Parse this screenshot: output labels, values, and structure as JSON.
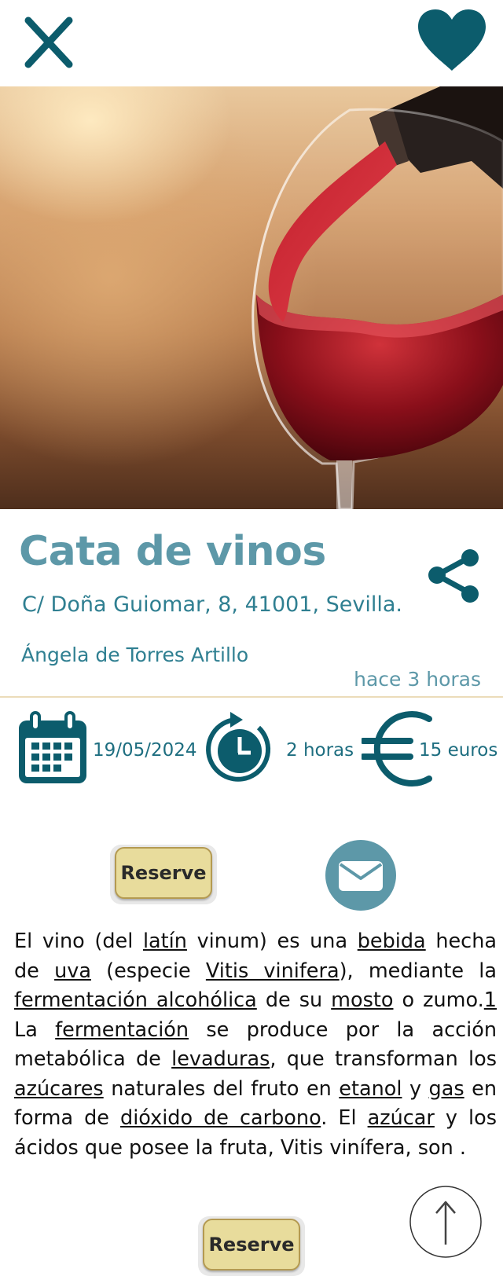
{
  "header": {
    "close_icon": "close-x-icon",
    "favorite_icon": "heart-icon",
    "icon_color": "#0c5c6c"
  },
  "hero": {
    "image": "red wine pouring into glass",
    "subject": "wine-glass-photo"
  },
  "event": {
    "title": "Cata de vinos",
    "address": "C/ Doña Guiomar, 8, 41001, Sevilla.",
    "organizer": "Ángela de Torres Artillo",
    "posted": "hace 3 horas",
    "share_icon": "share-icon",
    "accent_color": "#5d98a8",
    "date": "19/05/2024",
    "duration": "2 horas",
    "price": "15 euros"
  },
  "actions": {
    "reserve_label": "Reserve",
    "reserve_bottom_label": "Reserve",
    "mail_icon": "envelope-icon",
    "scroll_top_icon": "arrow-up-icon"
  },
  "description": {
    "segments": [
      {
        "text": "El vino (del ",
        "link": false
      },
      {
        "text": "latín",
        "link": true
      },
      {
        "text": " vinum) es una ",
        "link": false
      },
      {
        "text": "bebida",
        "link": true
      },
      {
        "text": " hecha de ",
        "link": false
      },
      {
        "text": "uva",
        "link": true
      },
      {
        "text": " (especie ",
        "link": false
      },
      {
        "text": "Vitis vinifera",
        "link": true
      },
      {
        "text": "), mediante la ",
        "link": false
      },
      {
        "text": "fermentación alcohólica",
        "link": true
      },
      {
        "text": " de su ",
        "link": false
      },
      {
        "text": "mosto",
        "link": true
      },
      {
        "text": " o zumo.",
        "link": false
      },
      {
        "text": "1",
        "link": true
      },
      {
        "text": " La ",
        "link": false
      },
      {
        "text": "fermentación",
        "link": true
      },
      {
        "text": " se produce por la acción metabólica de ",
        "link": false
      },
      {
        "text": "levaduras",
        "link": true
      },
      {
        "text": ", que transforman los ",
        "link": false
      },
      {
        "text": "azúcares",
        "link": true
      },
      {
        "text": " naturales del fruto en ",
        "link": false
      },
      {
        "text": "etanol",
        "link": true
      },
      {
        "text": " y ",
        "link": false
      },
      {
        "text": "gas",
        "link": true
      },
      {
        "text": " en forma de ",
        "link": false
      },
      {
        "text": "dióxido de carbono",
        "link": true
      },
      {
        "text": ". El ",
        "link": false
      },
      {
        "text": "azúcar",
        "link": true
      },
      {
        "text": " y los ácidos que posee la fruta, Vitis vinífera, son .",
        "link": false
      }
    ]
  }
}
